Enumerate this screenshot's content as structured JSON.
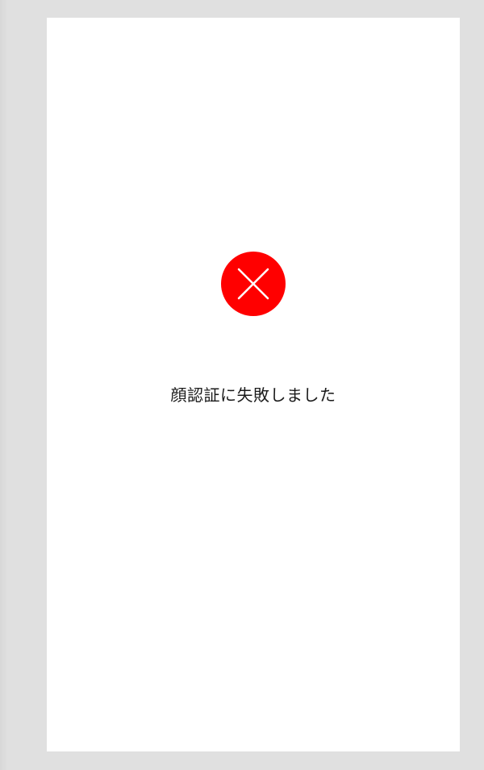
{
  "result": {
    "status": "error",
    "icon": "close-icon",
    "accent_color": "#ff0000",
    "message": "顔認証に失敗しました"
  }
}
